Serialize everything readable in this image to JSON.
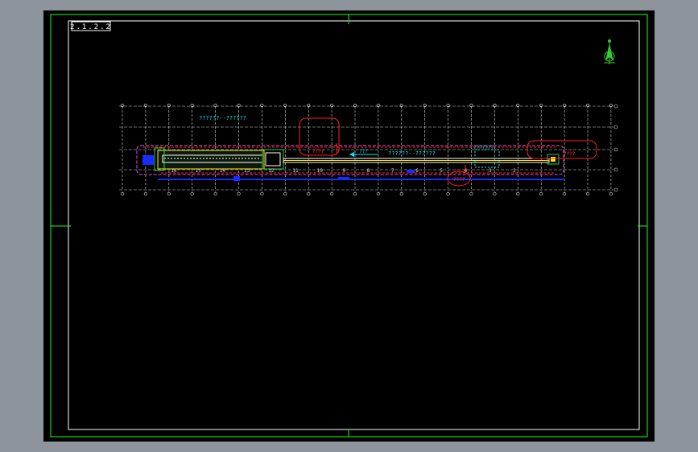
{
  "colors": {
    "viewport_bg": "#8d949c",
    "sheet_bg": "#000000",
    "frame": "#19ff19",
    "inner_frame": "#ffffff",
    "grid": "#dcdcdc",
    "accent_cyan": "#19e6e6",
    "accent_red": "#ff2020",
    "accent_blue": "#1a2bff",
    "accent_magenta": "#e84fd9",
    "accent_yellow": "#ffe819",
    "accent_green": "#33cc33"
  },
  "title_block": {
    "label": "2.1.2.2"
  },
  "drawing": {
    "title_left": "??????--??????",
    "title_right": "??????--??????",
    "arrow_label": "???",
    "box_label": "???????",
    "red_label_1": "????",
    "red_label_2": "????",
    "red_label_3": "????",
    "bay_numbers": [
      "16",
      "15",
      "14",
      "13",
      "12",
      "11",
      "10",
      "9",
      "8",
      "7",
      "6",
      "5",
      "4",
      "3",
      "2"
    ],
    "axis_bubbles_count": 22
  },
  "icons": {
    "north_arrow": "north-arrow-icon"
  }
}
